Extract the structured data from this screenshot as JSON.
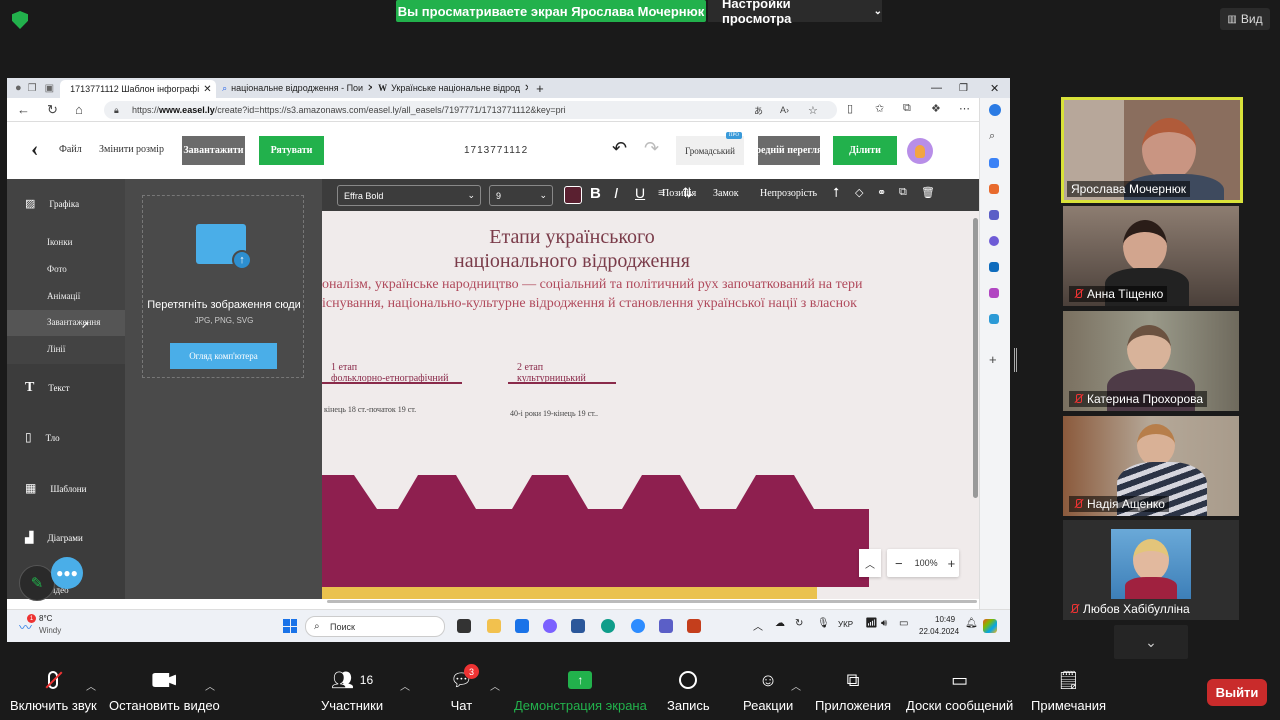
{
  "zoom": {
    "share_banner": "Вы просматриваете экран Ярослава Мочернюк",
    "view_settings": "Настройки просмотра",
    "view_button": "Вид",
    "leave": "Выйти",
    "participants_count": "16",
    "chat_badge": "3",
    "controls": {
      "unmute": "Включить звук",
      "stop_video": "Остановить видео",
      "participants": "Участники",
      "chat": "Чат",
      "share_screen": "Демонстрация экрана",
      "record": "Запись",
      "reactions": "Реакции",
      "apps": "Приложения",
      "whiteboards": "Доски сообщений",
      "notes": "Примечания"
    },
    "participants": [
      {
        "name": "Ярослава Мочернюк"
      },
      {
        "name": "Анна Тіщенко"
      },
      {
        "name": "Катерина Прохорова"
      },
      {
        "name": "Надія Ащенко"
      },
      {
        "name": "Любов Хабібулліна"
      }
    ]
  },
  "browser": {
    "tabs": [
      {
        "label": "1713771112 Шаблон інфографі"
      },
      {
        "label": "національне відродження - Пои"
      },
      {
        "label": "Українське національне відрод"
      }
    ],
    "url_prefix": "https://",
    "url_host": "www.easel.ly",
    "url_rest": "/create?id=https://s3.amazonaws.com/easel.ly/all_easels/7197771/1713771112&key=pri"
  },
  "easel": {
    "file": "Файл",
    "resize": "Змінити розмір",
    "download": "Завантажити",
    "save": "Рятувати",
    "name": "1713771112",
    "public": "Громадський",
    "pro_badge": "ПРО",
    "preview": "Попередній перегляд",
    "share": "Ділити",
    "nav": {
      "graphics": "Графіка",
      "icons": "Іконки",
      "photo": "Фото",
      "animations": "Анімації",
      "uploads": "Завантаження",
      "lines": "Лінії",
      "text": "Текст",
      "background": "Тло",
      "templates": "Шаблони",
      "charts": "Діаграми",
      "video": "Відео"
    },
    "upload": {
      "title": "Перетягніть зображення сюди",
      "formats": "JPG, PNG, SVG",
      "browse": "Огляд комп'ютера"
    },
    "toolbar": {
      "font": "Effra Bold",
      "size": "9",
      "position": "Позиція",
      "lock": "Замок",
      "opacity": "Непрозорість"
    },
    "infographic": {
      "title_line1": "Етапи українського",
      "title_line2": "національного відродження",
      "body_line1": "оналізм, українське народництво — соціальний та політичний рух започаткований на тери",
      "body_line2": "існування, національно-культурне відродження й становлення української нації з власнок",
      "stage1_num": "1 етап",
      "stage1_name": "фольклорно-етнографічний",
      "stage1_date": "кінець 18 ст.-початок 19 ст.",
      "stage2_num": "2 етап",
      "stage2_name": "культурницький",
      "stage2_date": "40-і роки 19-кінець 19 ст.."
    },
    "zoom_level": "100%"
  },
  "taskbar": {
    "temp": "8°C",
    "weather": "Windy",
    "search": "Поиск",
    "lang": "УКР",
    "time": "10:49",
    "date": "22.04.2024"
  },
  "colors": {
    "green": "#22b14c",
    "maroon": "#8e1f4f",
    "title": "#7a3b49",
    "body": "#b04a5c"
  }
}
